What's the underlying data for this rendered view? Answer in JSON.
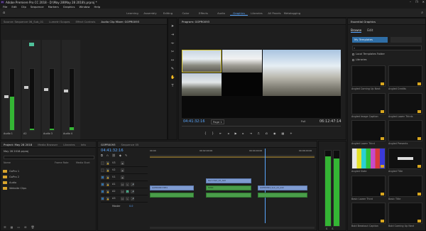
{
  "app": {
    "title": "Adobe Premiere Pro CC 2018 - D:\\May 28\\May 28 2018\\\\.prproj *",
    "window_controls": [
      "–",
      "❐",
      "✕"
    ]
  },
  "menu": [
    "File",
    "Edit",
    "Clip",
    "Sequence",
    "Markers",
    "Graphics",
    "Window",
    "Help"
  ],
  "workspaces": {
    "tabs": [
      "Learning",
      "Assembly",
      "Editing",
      "Color",
      "Effects",
      "Audio",
      "Graphics",
      "Libraries",
      "All Panels",
      "Metalogging"
    ],
    "active": "Graphics"
  },
  "source_panel": {
    "tabs": [
      "Source: Sequence 06_Sub_01",
      "Lumetri Scopes",
      "Effect Controls",
      "Audio Clip Mixer: GOPR0093"
    ],
    "active_tab": "Audio Clip Mixer: GOPR0093",
    "channels": [
      "Audio 1",
      "A2",
      "Audio 3",
      "Audio 4"
    ],
    "meter_levels": [
      0.55,
      0.02,
      0.02,
      0.05
    ]
  },
  "program_monitor": {
    "title": "Program: GOPR0093",
    "timecode_left": "04:41:32:16",
    "page_label": "Page 1",
    "quality": "Full",
    "timecode_right": "06:12:47:14"
  },
  "essential_graphics": {
    "title": "Essential Graphics",
    "tabs": [
      "Browse",
      "Edit"
    ],
    "active_tab": "Browse",
    "source_dropdown": "My Templates",
    "search_placeholder": "",
    "checkbox_local": "Local Templates Folder",
    "checkbox_libraries": "Libraries",
    "templates": [
      {
        "name": "Angled Coming Up Next",
        "style": "dark"
      },
      {
        "name": "Angled Credits",
        "style": "dark"
      },
      {
        "name": "Angled Image Caption",
        "style": "dark"
      },
      {
        "name": "Angled Lower Thirds",
        "style": "dark"
      },
      {
        "name": "Angled Lower Third",
        "style": "dark"
      },
      {
        "name": "Angled Presents",
        "style": "dark"
      },
      {
        "name": "Angled Slate",
        "style": "bars"
      },
      {
        "name": "Angled Title",
        "style": "title"
      },
      {
        "name": "Basic Lower Third",
        "style": "dark"
      },
      {
        "name": "Basic Title",
        "style": "dark"
      },
      {
        "name": "Bold Breakout Caption",
        "style": "dark"
      },
      {
        "name": "Bold Coming Up Next",
        "style": "dark"
      }
    ]
  },
  "project_panel": {
    "tabs": [
      "Project: May 28 2018",
      "Media Browser",
      "Libraries",
      "Info"
    ],
    "active_tab": "Project: May 28 2018",
    "file_label": "May 28 2018.prproj",
    "column_headers": [
      "Name",
      "Frame Rate",
      "Media Start"
    ],
    "items": [
      "GoPro 1",
      "GoPro 2",
      "Audio",
      "Website Clips"
    ]
  },
  "timeline": {
    "tabs": [
      "GOPR0093",
      "Sequence 05"
    ],
    "active_tab": "GOPR0093",
    "timecode": "04:41:32:16",
    "ruler_labels": [
      "00:00",
      "00:02:00:00",
      "00:04:00:00",
      "00:06:00:00",
      "00:08:00:00"
    ],
    "track_labels": [
      "V3",
      "V2",
      "V1",
      "A1",
      "A2",
      "A3"
    ],
    "master_label": "Master",
    "master_value": "0.0",
    "clips": [
      {
        "name": "GOPR0093.MP4",
        "track": "V1"
      },
      {
        "name": "Recorded_Ad_A22",
        "track": "V2"
      },
      {
        "name": "GOPR0094_Sub_Ad_A22",
        "track": "V1"
      },
      {
        "name": "SYNC",
        "track": "A1"
      }
    ]
  },
  "colors": {
    "accent": "#5aa7ff",
    "video_clip": "#7f9bd0",
    "audio_clip": "#4a9d4a",
    "meter_green": "#34b534",
    "folder": "#d9a42c",
    "template_badge": "#d8a61e"
  }
}
